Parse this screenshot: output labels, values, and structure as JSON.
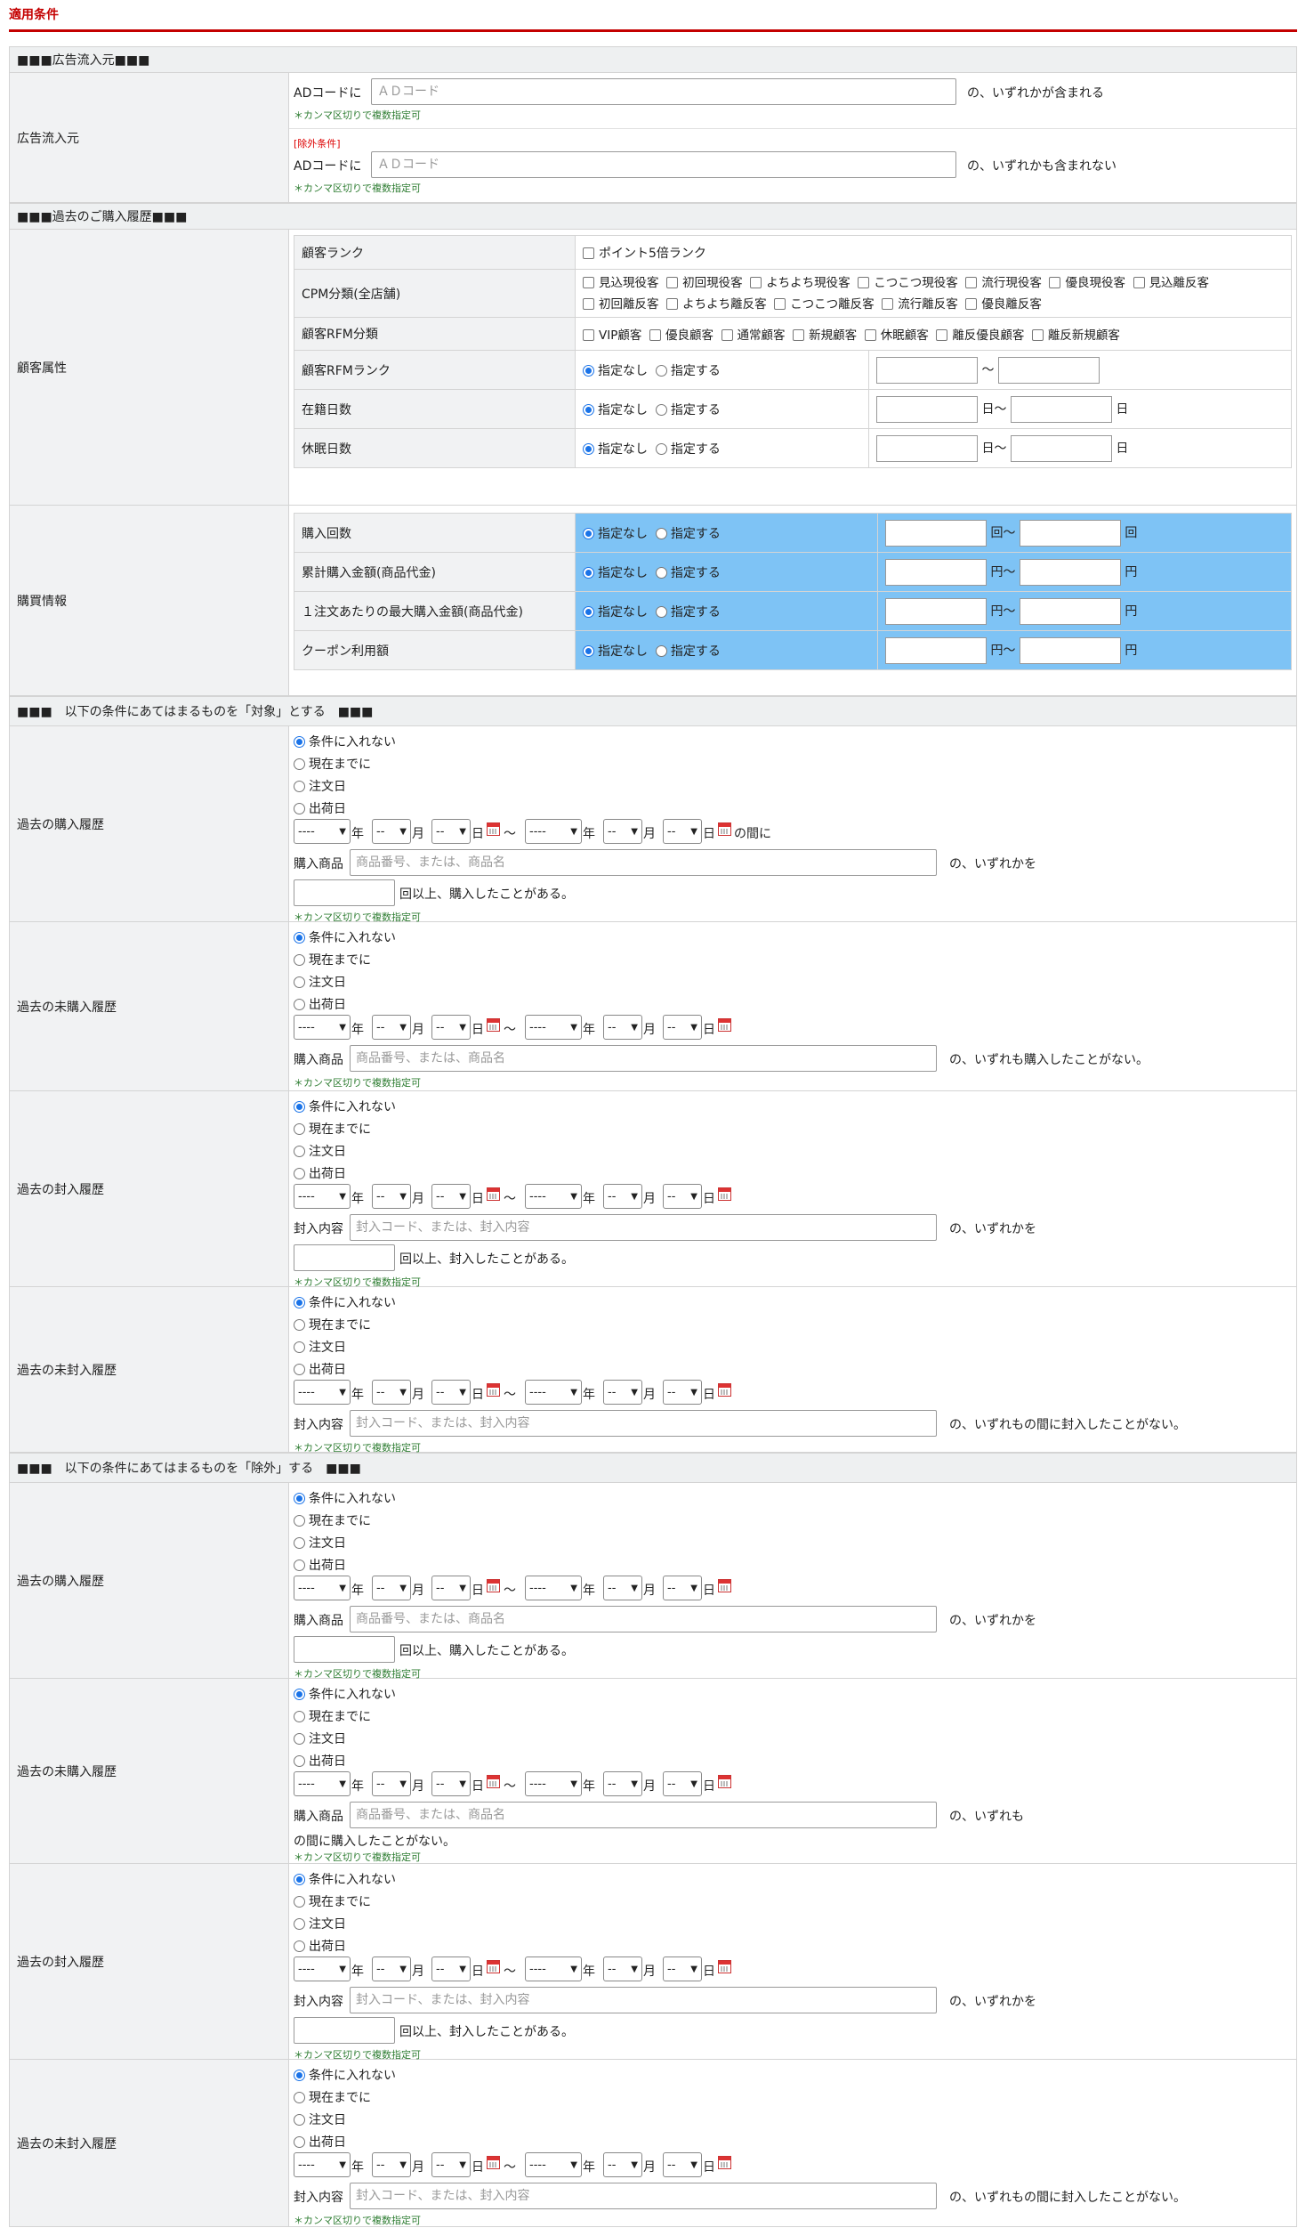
{
  "title": "適用条件",
  "sections": {
    "ad": "■■■広告流入元■■■",
    "history": "■■■過去のご購入履歴■■■",
    "target": "■■■　以下の条件にあてはまるものを「対象」とする　■■■",
    "exclude": "■■■　以下の条件にあてはまるものを「除外」する　■■■"
  },
  "ad": {
    "label": "広告流入元",
    "field_label": "ADコードに",
    "placeholder": "ＡＤコード",
    "include_suffix": "の、いずれかが含まれる",
    "exclude_tag": "[除外条件]",
    "exclude_suffix": "の、いずれかも含まれない",
    "note": "＊カンマ区切りで複数指定可"
  },
  "customer": {
    "label": "顧客属性",
    "rank_label": "顧客ランク",
    "rank_option": "ポイント5倍ランク",
    "cpm_label": "CPM分類(全店舗)",
    "cpm_options": [
      "見込現役客",
      "初回現役客",
      "よちよち現役客",
      "こつこつ現役客",
      "流行現役客",
      "優良現役客",
      "見込離反客",
      "初回離反客",
      "よちよち離反客",
      "こつこつ離反客",
      "流行離反客",
      "優良離反客"
    ],
    "rfm_label": "顧客RFM分類",
    "rfm_options": [
      "VIP顧客",
      "優良顧客",
      "通常顧客",
      "新規顧客",
      "休眠顧客",
      "離反優良顧客",
      "離反新規顧客"
    ],
    "rfm_rank_label": "顧客RFMランク",
    "tenure_label": "在籍日数",
    "dormant_label": "休眠日数",
    "none": "指定なし",
    "specify": "指定する",
    "tilde": "〜",
    "day_tilde": "日〜",
    "day": "日"
  },
  "purchase": {
    "label": "購買情報",
    "rows": [
      {
        "name": "購入回数",
        "unit_from": "回〜",
        "unit_to": "回"
      },
      {
        "name": "累計購入金額(商品代金)",
        "unit_from": "円〜",
        "unit_to": "円"
      },
      {
        "name": "１注文あたりの最大購入金額(商品代金)",
        "unit_from": "円〜",
        "unit_to": "円"
      },
      {
        "name": "クーポン利用額",
        "unit_from": "円〜",
        "unit_to": "円"
      }
    ],
    "none": "指定なし",
    "specify": "指定する"
  },
  "common": {
    "opt_none": "条件に入れない",
    "opt_now": "現在までに",
    "opt_order": "注文日",
    "opt_ship": "出荷日",
    "year_sel": "----",
    "md_sel": "--",
    "year": "年",
    "month": "月",
    "day": "日",
    "tilde": "〜",
    "between": "の間に",
    "note": "＊カンマ区切りで複数指定可",
    "goods_label": "購入商品",
    "goods_ph": "商品番号、または、商品名",
    "enc_label": "封入内容",
    "enc_ph": "封入コード、または、封入内容",
    "any": "の、いずれかを",
    "times_buy": "回以上、購入したことがある。",
    "times_enc": "回以上、封入したことがある。",
    "never_buy": "の、いずれも購入したことがない。",
    "never_enc": "の、いずれもの間に封入したことがない。",
    "split_a": "の、いずれも",
    "split_b": "の間に購入したことがない。"
  },
  "blocks": [
    {
      "label": "過去の購入履歴"
    },
    {
      "label": "過去の未購入履歴"
    },
    {
      "label": "過去の封入履歴"
    },
    {
      "label": "過去の未封入履歴"
    },
    {
      "label": "過去の購入履歴"
    },
    {
      "label": "過去の未購入履歴"
    },
    {
      "label": "過去の封入履歴"
    },
    {
      "label": "過去の未封入履歴"
    }
  ]
}
